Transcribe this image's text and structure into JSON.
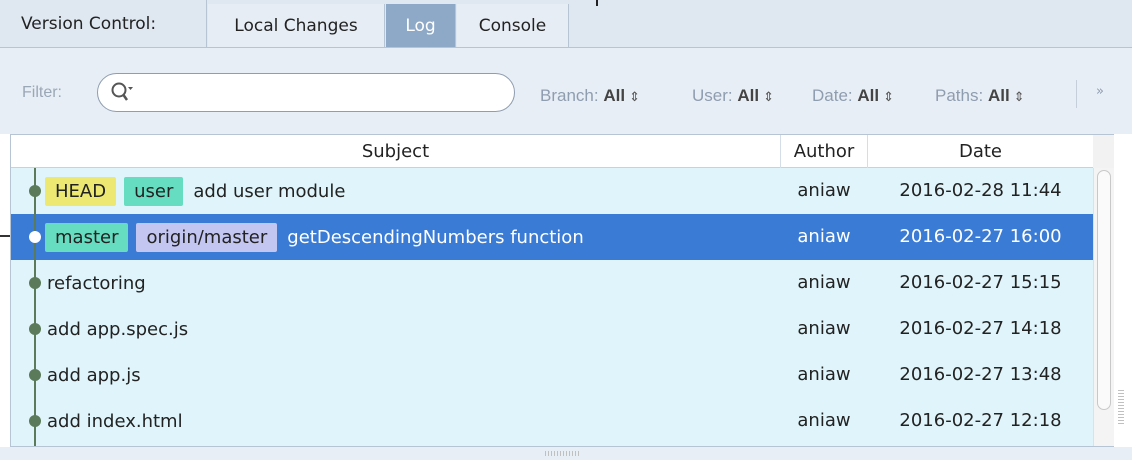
{
  "tabbar": {
    "title": "Version Control:",
    "tabs": [
      {
        "label": "Local Changes",
        "active": false
      },
      {
        "label": "Log",
        "active": true
      },
      {
        "label": "Console",
        "active": false
      }
    ]
  },
  "toolbar": {
    "filter_label": "Filter:",
    "search": {
      "value": "",
      "placeholder": ""
    },
    "branch": {
      "label": "Branch:",
      "value": "All"
    },
    "user": {
      "label": "User:",
      "value": "All"
    },
    "date": {
      "label": "Date:",
      "value": "All"
    },
    "paths": {
      "label": "Paths:",
      "value": "All"
    },
    "more": "»",
    "dropdown_arrow": "⇕"
  },
  "table": {
    "columns": {
      "subject": "Subject",
      "author": "Author",
      "date": "Date"
    },
    "rows": [
      {
        "tags": [
          {
            "label": "HEAD",
            "kind": "head"
          },
          {
            "label": "user",
            "kind": "branch"
          }
        ],
        "subject": "add user module",
        "author": "aniaw",
        "date": "2016-02-28 11:44",
        "selected": false
      },
      {
        "tags": [
          {
            "label": "master",
            "kind": "branch"
          },
          {
            "label": "origin/master",
            "kind": "remote"
          }
        ],
        "subject": "getDescendingNumbers function",
        "author": "aniaw",
        "date": "2016-02-27 16:00",
        "selected": true
      },
      {
        "tags": [],
        "subject": "refactoring",
        "author": "aniaw",
        "date": "2016-02-27 15:15",
        "selected": false
      },
      {
        "tags": [],
        "subject": "add app.spec.js",
        "author": "aniaw",
        "date": "2016-02-27 14:18",
        "selected": false
      },
      {
        "tags": [],
        "subject": "add app.js",
        "author": "aniaw",
        "date": "2016-02-27 13:48",
        "selected": false
      },
      {
        "tags": [],
        "subject": "add index.html",
        "author": "aniaw",
        "date": "2016-02-27 12:18",
        "selected": false
      }
    ]
  },
  "colors": {
    "selection": "#3a7bd5",
    "row_background": "#e0f5fb",
    "head_tag": "#ece872",
    "branch_tag": "#66dcc0",
    "remote_tag": "#c3c6f1",
    "active_tab": "#8ea9c8"
  }
}
